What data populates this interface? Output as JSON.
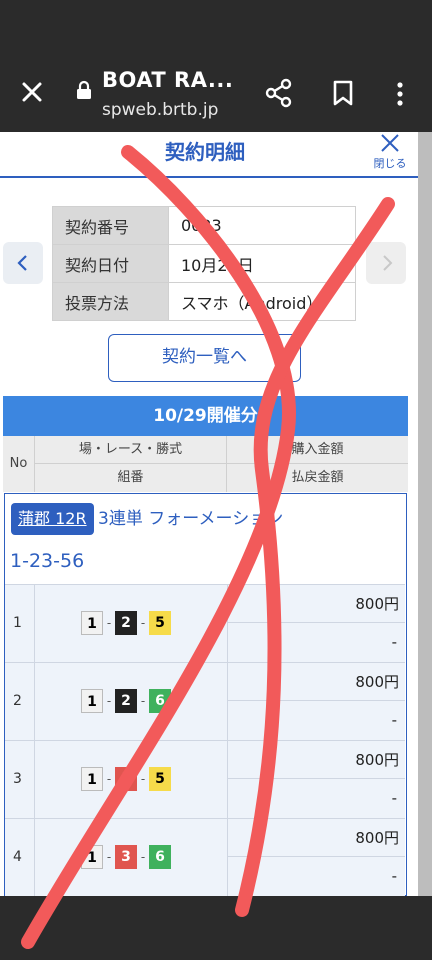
{
  "browser": {
    "title": "BOAT RA...",
    "url": "spweb.brtb.jp"
  },
  "page": {
    "title": "契約明細",
    "close_label": "閉じる"
  },
  "info": {
    "rows": [
      {
        "key": "契約番号",
        "value": "0023"
      },
      {
        "key": "契約日付",
        "value": "10月29日"
      },
      {
        "key": "投票方法",
        "value": "スマホ（Android）"
      }
    ]
  },
  "list_button": "契約一覧へ",
  "day_band": "10/29開催分",
  "table_header": {
    "no": "No",
    "col1_top": "場・レース・勝式",
    "col1_bottom": "組番",
    "col2_top": "購入金額",
    "col2_bottom": "払戻金額"
  },
  "ticket": {
    "venue_race": "蒲郡 12R",
    "bet_type": "3連単 フォーメーション",
    "combination": "1-23-56",
    "rows": [
      {
        "no": "1",
        "first": "1",
        "second": "2",
        "third": "5",
        "amount": "800円",
        "payout": "-"
      },
      {
        "no": "2",
        "first": "1",
        "second": "2",
        "third": "6",
        "amount": "800円",
        "payout": "-"
      },
      {
        "no": "3",
        "first": "1",
        "second": "3",
        "third": "5",
        "amount": "800円",
        "payout": "-"
      },
      {
        "no": "4",
        "first": "1",
        "second": "3",
        "third": "6",
        "amount": "800円",
        "payout": "-"
      }
    ]
  },
  "colors": {
    "accent": "#2e5fbf",
    "band": "#3c86e0",
    "overlay_mark": "#f25a5a"
  }
}
